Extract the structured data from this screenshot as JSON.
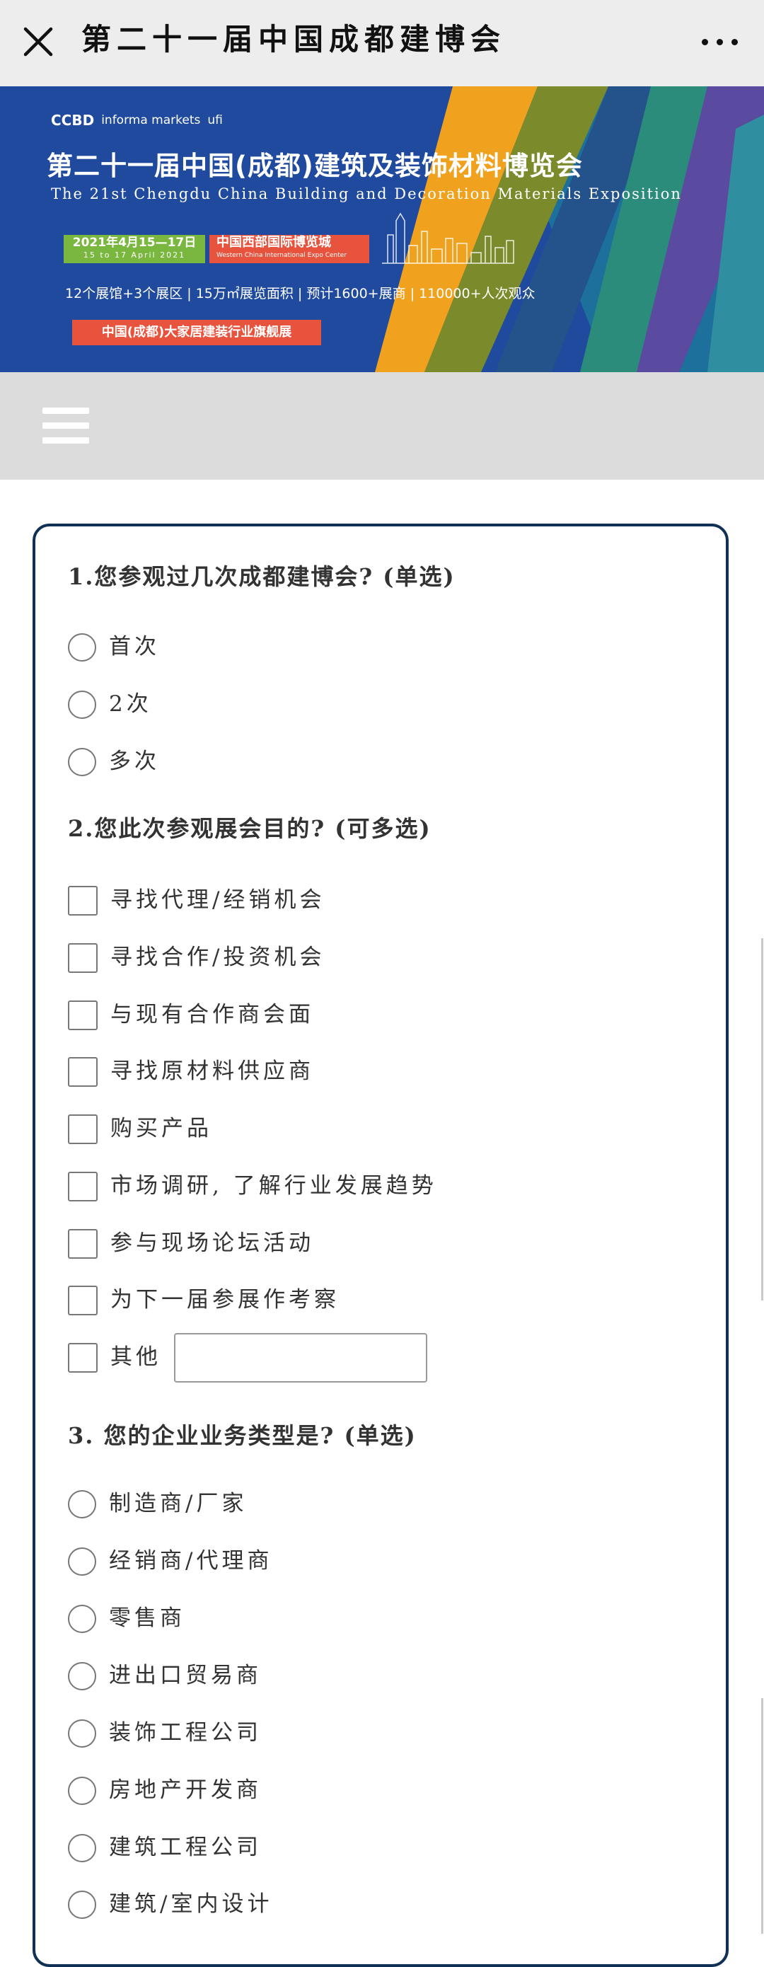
{
  "header": {
    "title": "第二十一届中国成都建博会"
  },
  "banner": {
    "logo_ccbd": "CCBD",
    "logo_informa": "informa markets",
    "logo_ufi": "ufi",
    "title": "第二十一届中国(成都)建筑及装饰材料博览会",
    "subtitle": "The 21st Chengdu China Building and Decoration Materials Exposition",
    "date_cn": "2021年4月15—17日",
    "date_en": "15 to 17 April 2021",
    "venue_cn": "中国西部国际博览城",
    "venue_en": "Western China International Expo Center",
    "stats": "12个展馆+3个展区 | 15万㎡展览面积 | 预计1600+展商 | 110000+人次观众",
    "tagline": "中国(成都)大家居建装行业旗舰展"
  },
  "form": {
    "q1": {
      "title": "1.您参观过几次成都建博会? (单选)",
      "options": [
        "首次",
        "2次",
        "多次"
      ]
    },
    "q2": {
      "title": "2.您此次参观展会目的? (可多选)",
      "options": [
        "寻找代理/经销机会",
        "寻找合作/投资机会",
        "与现有合作商会面",
        "寻找原材料供应商",
        "购买产品",
        "市场调研, 了解行业发展趋势",
        "参与现场论坛活动",
        "为下一届参展作考察",
        "其他"
      ]
    },
    "q3": {
      "title": "3. 您的企业业务类型是? (单选)",
      "options": [
        "制造商/厂家",
        "经销商/代理商",
        "零售商",
        "进出口贸易商",
        "装饰工程公司",
        "房地产开发商",
        "建筑工程公司",
        "建筑/室内设计"
      ]
    }
  }
}
